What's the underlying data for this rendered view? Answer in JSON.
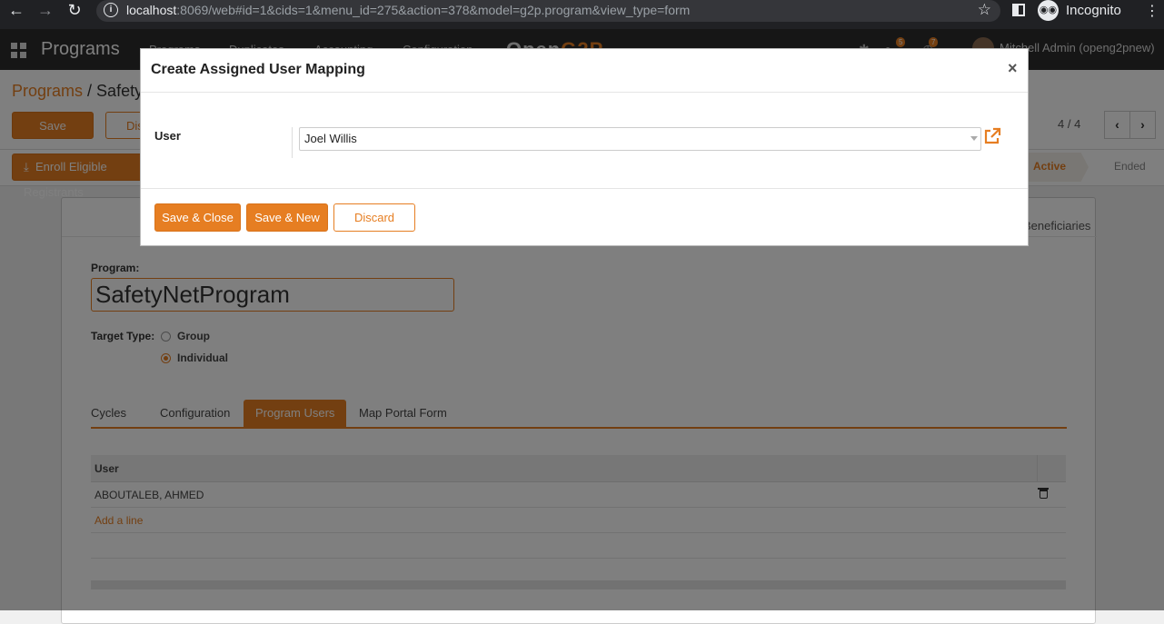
{
  "browser": {
    "url_host": "localhost",
    "url_rest": ":8069/web#id=1&cids=1&menu_id=275&action=378&model=g2p.program&view_type=form",
    "incognito_label": "Incognito"
  },
  "navbar": {
    "brand": "Programs",
    "menus": [
      "Programs",
      "Duplicates",
      "Accounting",
      "Configuration"
    ],
    "logo_a": "Open",
    "logo_b": "G2P",
    "messages_count": "5",
    "activities_count": "7",
    "user": "Mitchell Admin (openg2pnew)"
  },
  "control": {
    "breadcrumb_parent": "Programs",
    "breadcrumb_sep": " / ",
    "breadcrumb_current": "SafetyNetProgram",
    "save_label": "Save",
    "discard_label": "Discard",
    "pager": "4 / 4",
    "prev_icon": "‹",
    "next_icon": "›"
  },
  "statusbar": {
    "enroll_label": "Enroll Eligible Registrants",
    "stages": [
      "Active",
      "Ended"
    ],
    "current_stage": "Active"
  },
  "form": {
    "smart_button_label": "Beneficiaries",
    "program_label": "Program:",
    "program_name": "SafetyNetProgram",
    "target_type_label": "Target Type:",
    "target_options": [
      "Group",
      "Individual"
    ],
    "target_selected": "Individual",
    "tabs": [
      "Cycles",
      "Configuration",
      "Program Users",
      "Map Portal Form"
    ],
    "active_tab": "Program Users",
    "users_table": {
      "columns": [
        "User"
      ],
      "rows": [
        [
          "ABOUTALEB, AHMED"
        ]
      ]
    },
    "add_line_label": "Add a line"
  },
  "modal": {
    "title": "Create Assigned User Mapping",
    "close_icon": "×",
    "user_label": "User",
    "user_value": "Joel Willis",
    "save_close_label": "Save & Close",
    "save_new_label": "Save & New",
    "discard_label": "Discard"
  },
  "colors": {
    "accent": "#e67e22",
    "navbar": "#2c2c2c",
    "overlay": "rgba(0,0,0,0.5)"
  }
}
